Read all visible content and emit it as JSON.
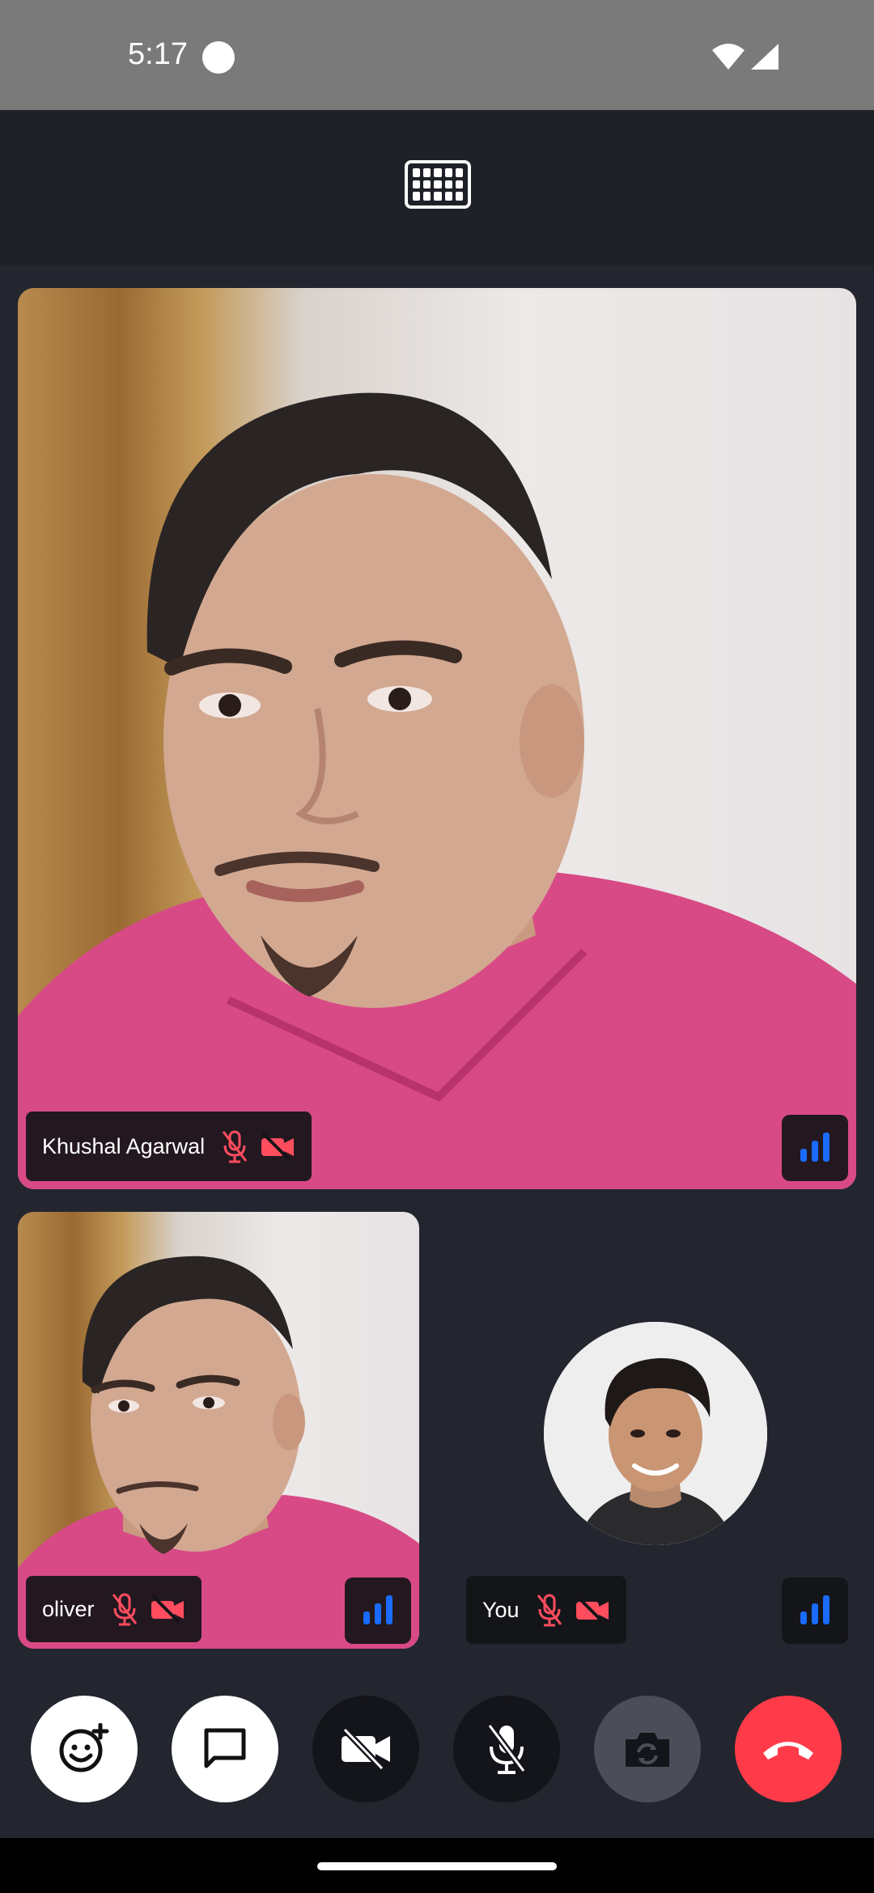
{
  "status_bar": {
    "time": "5:17"
  },
  "top_bar": {
    "layout_icon": "grid-layout-icon"
  },
  "participants": [
    {
      "name": "Khushal Agarwal",
      "mic": "muted",
      "camera": "off",
      "network": "good"
    },
    {
      "name": "oliver",
      "mic": "muted",
      "camera": "off",
      "network": "good"
    },
    {
      "name": "You",
      "mic": "muted",
      "camera": "off",
      "network": "good"
    }
  ],
  "controls": [
    {
      "icon": "emoji-reaction-icon"
    },
    {
      "icon": "chat-icon"
    },
    {
      "icon": "video-off-icon"
    },
    {
      "icon": "mic-off-icon"
    },
    {
      "icon": "flip-camera-icon"
    },
    {
      "icon": "end-call-icon"
    }
  ],
  "colors": {
    "accent_blue": "#1a6bff",
    "muted_red": "#ff4d5e",
    "end_call": "#ff3b4a",
    "background": "#23262f"
  }
}
